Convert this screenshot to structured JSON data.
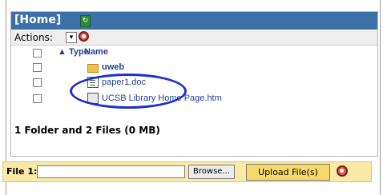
{
  "panel": {
    "title": "[Home]",
    "actions_label": "Actions:",
    "select_value": "▾",
    "columns": {
      "type": "Type",
      "name": "Name",
      "sort_marker": "▲"
    },
    "files": [
      {
        "name": "uweb",
        "kind": "folder"
      },
      {
        "name": "paper1.doc",
        "kind": "doc"
      },
      {
        "name": "UCSB Library Home Page.htm",
        "kind": "htm"
      }
    ],
    "summary": "1 Folder and 2 Files (0 MB)"
  },
  "upload": {
    "label": "File 1:",
    "browse_label": "Browse...",
    "upload_label": "Upload File(s)"
  },
  "edge_text": "s",
  "colors": {
    "title_bar": "#3d6fa8",
    "upload_bar": "#fbe9a8",
    "annotation": "#1d2fd0"
  }
}
